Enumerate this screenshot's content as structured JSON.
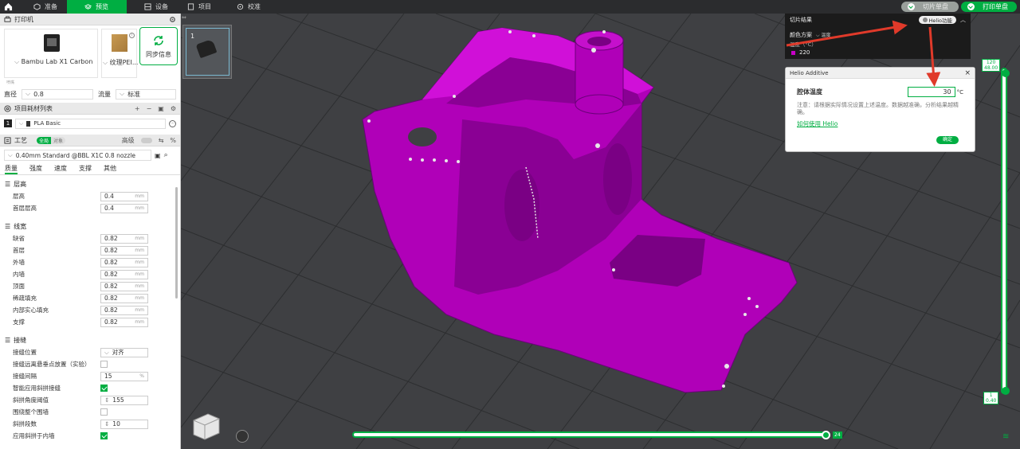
{
  "topbar": {
    "tabs": [
      {
        "label": "准备",
        "icon": "cube-icon"
      },
      {
        "label": "预览",
        "icon": "layers-icon"
      },
      {
        "label": "设备",
        "icon": "device-icon"
      },
      {
        "label": "项目",
        "icon": "folder-icon"
      },
      {
        "label": "校准",
        "icon": "target-icon"
      }
    ],
    "active_tab": 1,
    "slice_label": "切片单盘",
    "print_label": "打印单盘",
    "accent": "#00ae42"
  },
  "printer": {
    "section_title": "打印机",
    "printer_name": "Bambu Lab X1 Carbon",
    "plate_name": "纹理PEI...",
    "sync_label": "同步信息",
    "small_note": "喷嘴",
    "diameter_label": "直径",
    "diameter_value": "0.8",
    "flow_label": "流量",
    "flow_value": "标准"
  },
  "filament": {
    "section_title": "项目耗材列表",
    "slot": "1",
    "name": "PLA Basic"
  },
  "process": {
    "section_title": "工艺",
    "global_label": "全局",
    "object_label": "对象",
    "advanced_label": "高级",
    "profile": "0.40mm Standard @BBL X1C 0.8 nozzle",
    "tabs": [
      "质量",
      "强度",
      "速度",
      "支撑",
      "其他"
    ],
    "groups": {
      "layer_height": {
        "title": "层高",
        "rows": [
          {
            "label": "层高",
            "value": "0.4",
            "unit": "mm"
          },
          {
            "label": "首层层高",
            "value": "0.4",
            "unit": "mm"
          }
        ]
      },
      "line_width": {
        "title": "线宽",
        "rows": [
          {
            "label": "缺省",
            "value": "0.82",
            "unit": "mm"
          },
          {
            "label": "首层",
            "value": "0.82",
            "unit": "mm"
          },
          {
            "label": "外墙",
            "value": "0.82",
            "unit": "mm"
          },
          {
            "label": "内墙",
            "value": "0.82",
            "unit": "mm"
          },
          {
            "label": "顶面",
            "value": "0.82",
            "unit": "mm"
          },
          {
            "label": "稀疏填充",
            "value": "0.82",
            "unit": "mm"
          },
          {
            "label": "内部实心填充",
            "value": "0.82",
            "unit": "mm"
          },
          {
            "label": "支撑",
            "value": "0.82",
            "unit": "mm"
          }
        ]
      },
      "seam": {
        "title": "接缝",
        "position_label": "接缝位置",
        "position_value": "对齐",
        "overhang_label": "接缝远离悬垂点放置（实验）",
        "gap_label": "接缝间隔",
        "gap_value": "15",
        "gap_unit": "%",
        "smart_label": "智能应用斜拼接缝",
        "angle_label": "斜拼角度阈值",
        "angle_value": "155",
        "loop_label": "围绕整个围墙",
        "segments_label": "斜拼段数",
        "segments_value": "10",
        "inner_label": "应用斜拼于内墙"
      }
    }
  },
  "plate": {
    "number": "1"
  },
  "slice_result": {
    "title": "切片结果",
    "helio_label": "Helio功能",
    "scheme_label": "颜色方案",
    "scheme_value": "温度",
    "unit_row": "温度（°C）",
    "legend_value": "220",
    "legend_color": "#c800c8"
  },
  "helio": {
    "title": "Helio Additive",
    "chamber_label": "腔体温度",
    "chamber_value": "30",
    "chamber_unit": "°C",
    "note": "注意：请根据实际情况设置上述温度。数据越准确，分析结果越精确。",
    "link": "如何使用 Helio",
    "ok_label": "确定"
  },
  "layer_slider": {
    "top_layer": "120",
    "top_height": "48.00",
    "bottom_layer": "1",
    "bottom_height": "0.40"
  },
  "move_slider": {
    "value": "24"
  },
  "model_color": "#b000b8"
}
